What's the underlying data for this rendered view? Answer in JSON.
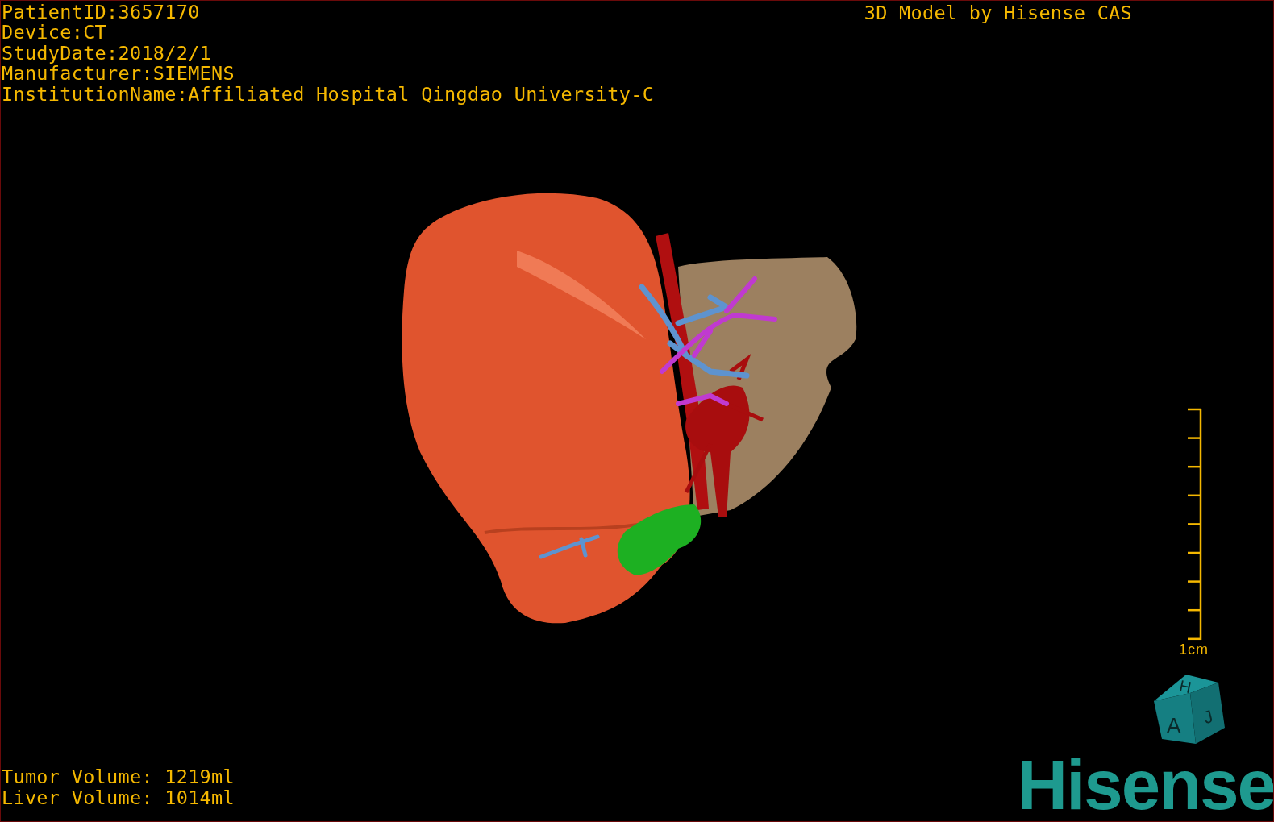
{
  "patient_info": [
    "PatientID:3657170",
    "Device:CT",
    "StudyDate:2018/2/1",
    "Manufacturer:SIEMENS",
    "InstitutionName:Affiliated Hospital Qingdao University-C"
  ],
  "title": "3D Model by Hisense CAS",
  "scale_bar": {
    "label": "1cm"
  },
  "volumes": [
    "Tumor Volume: 1219ml",
    "Liver Volume: 1014ml"
  ],
  "orientation_cube": {
    "labels": [
      "H",
      "A",
      "J"
    ]
  },
  "logo": "Hisense"
}
